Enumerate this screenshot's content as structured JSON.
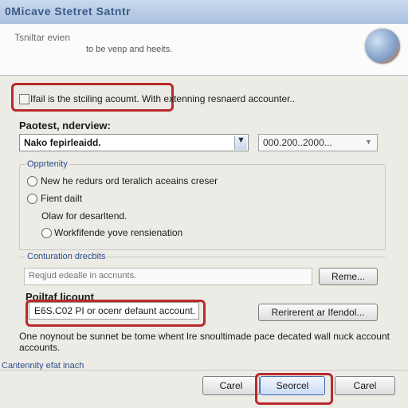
{
  "window": {
    "title": "0Micave Stetret Satntr"
  },
  "header": {
    "title": "Tsniltar evien",
    "subtitle": "to be venp and heeits."
  },
  "top_option": {
    "checked": false,
    "label": "Ifail is the stciling acoumt. With extenning resnaerd accounter.."
  },
  "partner": {
    "label": "Paotest, nderview:",
    "selected": "Nako fepirleaidd.",
    "date_value": "000.200..2000..."
  },
  "options": {
    "title": "Opprtenity",
    "items": [
      {
        "label": "New he redurs ord teralich aceains creser",
        "selected": false
      },
      {
        "label": "Fient dailt",
        "selected": false
      },
      {
        "label": "Workfifende yove rensienation",
        "selected": false
      }
    ],
    "sub_label": "Olaw for desarltend."
  },
  "configuration": {
    "title": "Conturation drecbits",
    "placeholder": "Reqjud edealle in accnunts.",
    "remove_label": "Reme..."
  },
  "product": {
    "label": "Poiltaf licount",
    "value": "E6S.C02 PI or ocenr defaunt account.",
    "redirect_label": "Rerirerent ar Ifendol..."
  },
  "note": "One noynout be sunnet be tome whent lre snoultimade pace decated wall nuck account accounts.",
  "footer": {
    "link": "Cantennity efat inach",
    "buttons": {
      "cancel_left": "Carel",
      "search": "Seorcel",
      "cancel_right": "Carel"
    }
  },
  "colors": {
    "highlight_ring": "#b82a2a",
    "accent_blue": "#2a4d8a"
  }
}
